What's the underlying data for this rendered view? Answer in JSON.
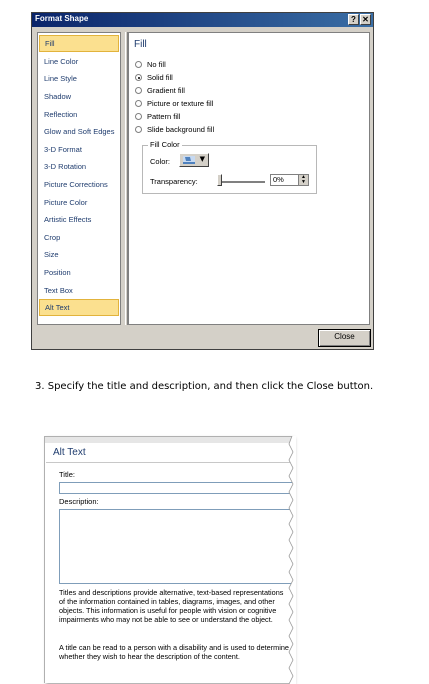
{
  "dialog": {
    "title": "Format Shape",
    "help_label": "?",
    "close_x_label": "✕",
    "nav_items": [
      {
        "label": "Fill",
        "selected": true
      },
      {
        "label": "Line Color"
      },
      {
        "label": "Line Style"
      },
      {
        "label": "Shadow"
      },
      {
        "label": "Reflection"
      },
      {
        "label": "Glow and Soft Edges"
      },
      {
        "label": "3-D Format"
      },
      {
        "label": "3-D Rotation"
      },
      {
        "label": "Picture Corrections"
      },
      {
        "label": "Picture Color"
      },
      {
        "label": "Artistic Effects"
      },
      {
        "label": "Crop"
      },
      {
        "label": "Size"
      },
      {
        "label": "Position"
      },
      {
        "label": "Text Box"
      },
      {
        "label": "Alt Text",
        "highlighted": true
      }
    ],
    "section_title": "Fill",
    "fill_options": [
      {
        "label": "No fill",
        "checked": false
      },
      {
        "label": "Solid fill",
        "checked": true
      },
      {
        "label": "Gradient fill",
        "checked": false
      },
      {
        "label": "Picture or texture fill",
        "checked": false
      },
      {
        "label": "Pattern fill",
        "checked": false
      },
      {
        "label": "Slide background fill",
        "checked": false
      }
    ],
    "fill_color_group": "Fill Color",
    "color_label": "Color:",
    "transparency_label": "Transparency:",
    "transparency_value": "0%",
    "close_button": "Close"
  },
  "instruction": "3.  Specify the title and description, and then click the Close button.",
  "alt_text": {
    "title": "Alt Text",
    "title_label": "Title:",
    "title_value": "",
    "description_label": "Description:",
    "description_value": "",
    "info_1": "Titles and descriptions provide alternative, text-based representations of the information contained in tables, diagrams, images, and other objects. This information is useful for people with vision or cognitive impairments who may not be able to see or understand the object.",
    "info_2": "A title can be read to a person with a disability and is used to determine whether they wish to hear the description of the content."
  },
  "colors": {
    "selected_bg": "#fbe08f",
    "title_bar": "#0a246a",
    "heading": "#1f3c6e"
  }
}
